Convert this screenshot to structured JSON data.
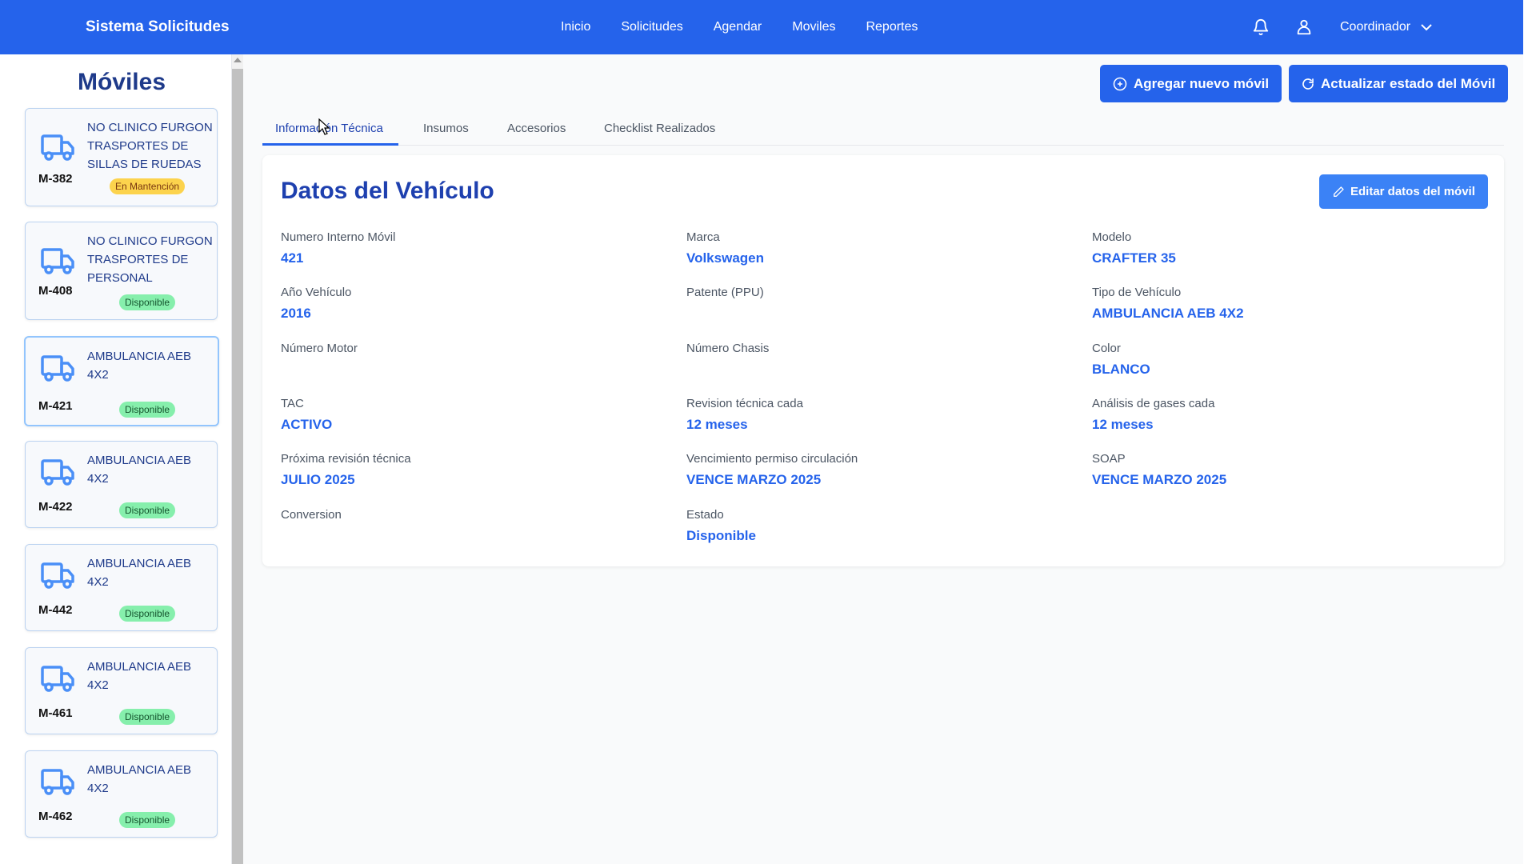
{
  "app": {
    "title": "Sistema Solicitudes"
  },
  "nav": {
    "items": [
      "Inicio",
      "Solicitudes",
      "Agendar",
      "Moviles",
      "Reportes"
    ]
  },
  "user": {
    "name": "Coordinador"
  },
  "sidebar": {
    "title": "Móviles",
    "items": [
      {
        "code": "M-382",
        "name": "NO CLINICO FURGON TRASPORTES DE SILLAS DE RUEDAS",
        "status": "En Mantención",
        "status_type": "warn"
      },
      {
        "code": "M-408",
        "name": "NO CLINICO FURGON TRASPORTES DE PERSONAL",
        "status": "Disponible",
        "status_type": "ok"
      },
      {
        "code": "M-421",
        "name": "AMBULANCIA AEB 4X2",
        "status": "Disponible",
        "status_type": "ok"
      },
      {
        "code": "M-422",
        "name": "AMBULANCIA AEB 4X2",
        "status": "Disponible",
        "status_type": "ok"
      },
      {
        "code": "M-442",
        "name": "AMBULANCIA AEB 4X2",
        "status": "Disponible",
        "status_type": "ok"
      },
      {
        "code": "M-461",
        "name": "AMBULANCIA AEB 4X2",
        "status": "Disponible",
        "status_type": "ok"
      },
      {
        "code": "M-462",
        "name": "AMBULANCIA AEB 4X2",
        "status": "Disponible",
        "status_type": "ok"
      }
    ]
  },
  "actions": {
    "add_label": "Agregar nuevo móvil",
    "update_label": "Actualizar estado del Móvil"
  },
  "tabs": [
    "Información Técnica",
    "Insumos",
    "Accesorios",
    "Checklist Realizados"
  ],
  "panel": {
    "title": "Datos del Vehículo",
    "edit_label": "Editar datos del móvil",
    "fields": [
      {
        "label": "Numero Interno Móvil",
        "value": "421"
      },
      {
        "label": "Marca",
        "value": "Volkswagen"
      },
      {
        "label": "Modelo",
        "value": "CRAFTER 35"
      },
      {
        "label": "Año Vehículo",
        "value": "2016"
      },
      {
        "label": "Patente (PPU)",
        "value": ""
      },
      {
        "label": "Tipo de Vehículo",
        "value": "AMBULANCIA AEB 4X2"
      },
      {
        "label": "Número Motor",
        "value": ""
      },
      {
        "label": "Número Chasis",
        "value": ""
      },
      {
        "label": "Color",
        "value": "BLANCO"
      },
      {
        "label": "TAC",
        "value": "ACTIVO"
      },
      {
        "label": "Revision técnica cada",
        "value": "12 meses"
      },
      {
        "label": "Análisis de gases cada",
        "value": "12 meses"
      },
      {
        "label": "Próxima revisión técnica",
        "value": "JULIO 2025"
      },
      {
        "label": "Vencimiento permiso circulación",
        "value": "VENCE MARZO 2025"
      },
      {
        "label": "SOAP",
        "value": "VENCE MARZO 2025"
      },
      {
        "label": "Conversion",
        "value": ""
      },
      {
        "label": "Estado",
        "value": "Disponible"
      }
    ]
  },
  "colors": {
    "primary": "#2563eb",
    "title": "#1e40af",
    "ok": "#86efac",
    "warn": "#fcd34d"
  }
}
